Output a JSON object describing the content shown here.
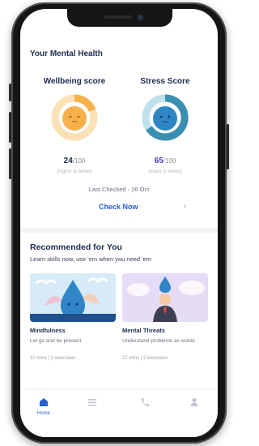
{
  "header": {
    "section_title": "Your Mental Health"
  },
  "wellbeing": {
    "title": "Wellbeing score",
    "value": "24",
    "denominator": "/100",
    "subtitle": "(higher is better)",
    "color": "#f6b14a"
  },
  "stress": {
    "title": "Stress Score",
    "value": "65",
    "denominator": "/100",
    "subtitle": "(lower is better)",
    "color": "#3a8fb0"
  },
  "last_checked": "Last Checked - 26 Oct",
  "check_now": "Check Now",
  "recommended": {
    "title": "Recommended for You",
    "subtitle": "Learn skills now, use 'em when you need 'em",
    "items": [
      {
        "name": "Mindfulness",
        "description": "Let go and be present",
        "meta": "10 mins | 2 exercises",
        "color": "#cfe4f6"
      },
      {
        "name": "Mental Threats",
        "description": "Understand problems as words",
        "meta": "12 mins | 2 exercises",
        "color": "#e4dcf4"
      }
    ]
  },
  "nav": {
    "items": [
      {
        "label": "Home",
        "icon": "home-icon",
        "active": true
      },
      {
        "label": "",
        "icon": "list-icon",
        "active": false
      },
      {
        "label": "",
        "icon": "phone-icon",
        "active": false
      },
      {
        "label": "",
        "icon": "profile-icon",
        "active": false
      }
    ]
  },
  "colors": {
    "accent": "#2760c9",
    "heading": "#1d2b4f"
  }
}
